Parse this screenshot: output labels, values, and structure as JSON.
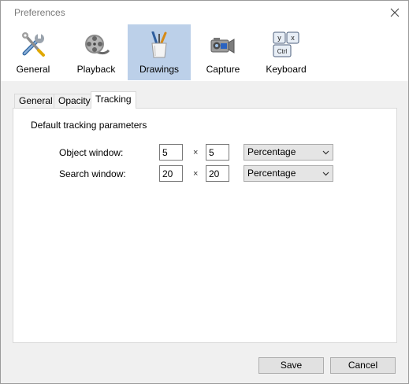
{
  "window": {
    "title": "Preferences"
  },
  "toolbar": {
    "items": [
      {
        "label": "General",
        "icon": "tools-icon"
      },
      {
        "label": "Playback",
        "icon": "film-reel-icon"
      },
      {
        "label": "Drawings",
        "icon": "brushes-cup-icon",
        "active": true
      },
      {
        "label": "Capture",
        "icon": "camera-icon"
      },
      {
        "label": "Keyboard",
        "icon": "keyboard-keys-icon",
        "keys": [
          "y",
          "x",
          "Ctrl"
        ]
      }
    ]
  },
  "tabs": [
    {
      "label": "General"
    },
    {
      "label": "Opacity"
    },
    {
      "label": "Tracking",
      "active": true
    }
  ],
  "tracking": {
    "section_title": "Default tracking parameters",
    "times_symbol": "×",
    "object_window": {
      "label": "Object window:",
      "width": "5",
      "height": "5",
      "unit": "Percentage"
    },
    "search_window": {
      "label": "Search window:",
      "width": "20",
      "height": "20",
      "unit": "Percentage"
    }
  },
  "buttons": {
    "save": "Save",
    "cancel": "Cancel"
  },
  "colors": {
    "active_toolbar": "#bcd0e9",
    "window_bg": "#f0f0f0",
    "panel_bg": "#ffffff"
  }
}
